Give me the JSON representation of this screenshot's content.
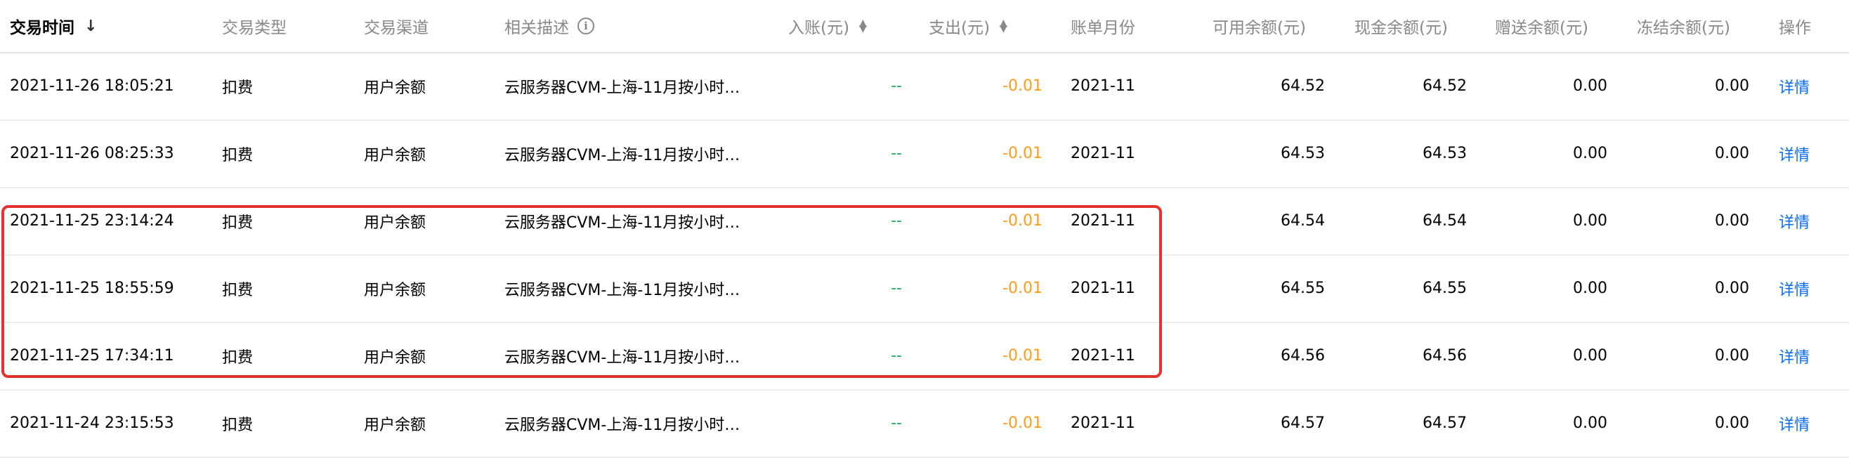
{
  "header": {
    "time": "交易时间",
    "type": "交易类型",
    "channel": "交易渠道",
    "desc": "相关描述",
    "income": "入账(元)",
    "expense": "支出(元)",
    "month": "账单月份",
    "available": "可用余额(元)",
    "cash": "现金余额(元)",
    "gift": "赠送余额(元)",
    "frozen": "冻结余额(元)",
    "action": "操作"
  },
  "icons": {
    "sort_desc": "↓",
    "sort_updown": "⇅",
    "info": "i"
  },
  "colors": {
    "income": "#19b35a",
    "expense": "#ff9c19",
    "link": "#0a6cf5",
    "highlight": "#e5332b"
  },
  "rows": [
    {
      "time": "2021-11-26 18:05:21",
      "type": "扣费",
      "channel": "用户余额",
      "desc": "云服务器CVM-上海-11月按小时…",
      "income": "--",
      "expense": "-0.01",
      "month": "2021-11",
      "available": "64.52",
      "cash": "64.52",
      "gift": "0.00",
      "frozen": "0.00",
      "action": "详情"
    },
    {
      "time": "2021-11-26 08:25:33",
      "type": "扣费",
      "channel": "用户余额",
      "desc": "云服务器CVM-上海-11月按小时…",
      "income": "--",
      "expense": "-0.01",
      "month": "2021-11",
      "available": "64.53",
      "cash": "64.53",
      "gift": "0.00",
      "frozen": "0.00",
      "action": "详情"
    },
    {
      "time": "2021-11-25 23:14:24",
      "type": "扣费",
      "channel": "用户余额",
      "desc": "云服务器CVM-上海-11月按小时…",
      "income": "--",
      "expense": "-0.01",
      "month": "2021-11",
      "available": "64.54",
      "cash": "64.54",
      "gift": "0.00",
      "frozen": "0.00",
      "action": "详情"
    },
    {
      "time": "2021-11-25 18:55:59",
      "type": "扣费",
      "channel": "用户余额",
      "desc": "云服务器CVM-上海-11月按小时…",
      "income": "--",
      "expense": "-0.01",
      "month": "2021-11",
      "available": "64.55",
      "cash": "64.55",
      "gift": "0.00",
      "frozen": "0.00",
      "action": "详情"
    },
    {
      "time": "2021-11-25 17:34:11",
      "type": "扣费",
      "channel": "用户余额",
      "desc": "云服务器CVM-上海-11月按小时…",
      "income": "--",
      "expense": "-0.01",
      "month": "2021-11",
      "available": "64.56",
      "cash": "64.56",
      "gift": "0.00",
      "frozen": "0.00",
      "action": "详情"
    },
    {
      "time": "2021-11-24 23:15:53",
      "type": "扣费",
      "channel": "用户余额",
      "desc": "云服务器CVM-上海-11月按小时…",
      "income": "--",
      "expense": "-0.01",
      "month": "2021-11",
      "available": "64.57",
      "cash": "64.57",
      "gift": "0.00",
      "frozen": "0.00",
      "action": "详情"
    }
  ]
}
